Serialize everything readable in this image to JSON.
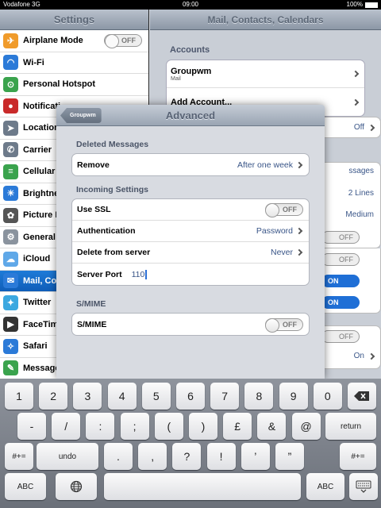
{
  "status_bar": {
    "carrier": "Vodafone 3G",
    "time": "09:00",
    "battery": "100%"
  },
  "sidebar": {
    "title": "Settings",
    "items": [
      {
        "label": "Airplane Mode",
        "icon": "airplane-icon",
        "color": "#f09b2b",
        "toggle": "OFF"
      },
      {
        "label": "Wi-Fi",
        "icon": "wifi-icon",
        "color": "#2b7ad8"
      },
      {
        "label": "Personal Hotspot",
        "icon": "hotspot-icon",
        "color": "#3aa34d"
      },
      {
        "label": "Notificati",
        "icon": "notifications-icon",
        "color": "#c92a2a"
      },
      {
        "label": "Location",
        "icon": "location-icon",
        "color": "#6d7a8a"
      },
      {
        "label": "Carrier",
        "icon": "phone-icon",
        "color": "#6d7a8a"
      },
      {
        "label": "Cellular",
        "icon": "cellular-icon",
        "color": "#3aa34d"
      },
      {
        "label": "Brightne",
        "icon": "brightness-icon",
        "color": "#2b7ad8"
      },
      {
        "label": "Picture F",
        "icon": "picture-frame-icon",
        "color": "#555"
      },
      {
        "label": "General",
        "icon": "gear-icon",
        "color": "#8a939e"
      },
      {
        "label": "iCloud",
        "icon": "cloud-icon",
        "color": "#5fa8e8"
      },
      {
        "label": "Mail, Co",
        "icon": "mail-icon",
        "color": "#2b7ad8",
        "selected": true
      },
      {
        "label": "Twitter",
        "icon": "twitter-icon",
        "color": "#3ba8e0"
      },
      {
        "label": "FaceTim",
        "icon": "facetime-icon",
        "color": "#333"
      },
      {
        "label": "Safari",
        "icon": "safari-icon",
        "color": "#2b7ad8"
      },
      {
        "label": "Message",
        "icon": "messages-icon",
        "color": "#3aa34d"
      }
    ]
  },
  "detail": {
    "title": "Mail, Contacts, Calendars",
    "accounts_title": "Accounts",
    "account_name": "Groupwm",
    "account_sub": "Mail",
    "add_account": "Add Account...",
    "peeks": {
      "off1": "Off",
      "messages": "ssages",
      "lines": "2 Lines",
      "medium": "Medium",
      "toggle_off": "OFF",
      "toggle_on": "ON",
      "on_text": "On"
    }
  },
  "modal": {
    "back_label": "Groupwm",
    "title": "Advanced",
    "deleted_title": "Deleted Messages",
    "remove_label": "Remove",
    "remove_value": "After one week",
    "incoming_title": "Incoming Settings",
    "ssl_label": "Use SSL",
    "ssl_value": "OFF",
    "auth_label": "Authentication",
    "auth_value": "Password",
    "delete_label": "Delete from server",
    "delete_value": "Never",
    "port_label": "Server Port",
    "port_value": "110",
    "smime_title": "S/MIME",
    "smime_label": "S/MIME",
    "smime_value": "OFF"
  },
  "keyboard": {
    "row1": [
      "1",
      "2",
      "3",
      "4",
      "5",
      "6",
      "7",
      "8",
      "9",
      "0"
    ],
    "row2": [
      "-",
      "/",
      ":",
      ";",
      "(",
      ")",
      "£",
      "&",
      "@"
    ],
    "row3": [
      ".",
      ",",
      "?",
      "!",
      "’",
      "”"
    ],
    "return": "return",
    "shift": "#+=",
    "undo": "undo",
    "abc": "ABC"
  }
}
